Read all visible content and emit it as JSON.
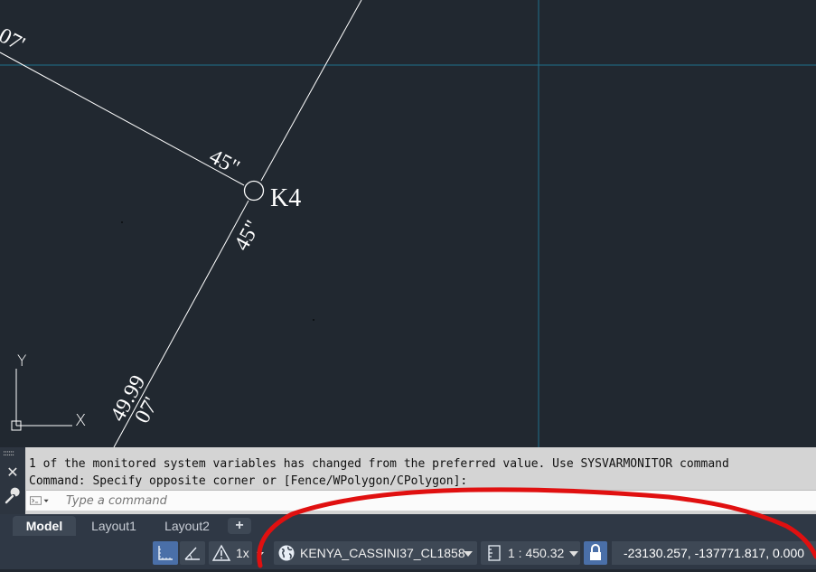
{
  "drawing": {
    "point_label": "K4",
    "label_upper_left_bearing": "07'",
    "label_upper_left_angle": "45\"",
    "label_lower_angle": "45\"",
    "label_lower_distance": "49.99",
    "label_lower_bearing": "07'",
    "ucs_y": "Y",
    "ucs_x": "X"
  },
  "command_panel": {
    "history_line_1": "1 of the monitored system variables has changed from the preferred value. Use SYSVARMONITOR command",
    "history_line_2": "Command: Specify opposite corner or [Fence/WPolygon/CPolygon]:",
    "input_placeholder": "Type a command"
  },
  "layout_tabs": {
    "model": "Model",
    "layout1": "Layout1",
    "layout2": "Layout2",
    "add": "+"
  },
  "status_bar": {
    "annotation_scale": "1x",
    "coordinate_system": "KENYA_CASSINI37_CL1858",
    "viewport_scale": "1 : 450.32",
    "coordinates": "-23130.257, -137771.817, 0.000"
  },
  "colors": {
    "canvas_background": "#212830",
    "crosshair": "#1f6f8c",
    "geometry": "#ffffff",
    "annotation_mark": "#e01010",
    "status_toggle_on": "#4a6fa8"
  }
}
